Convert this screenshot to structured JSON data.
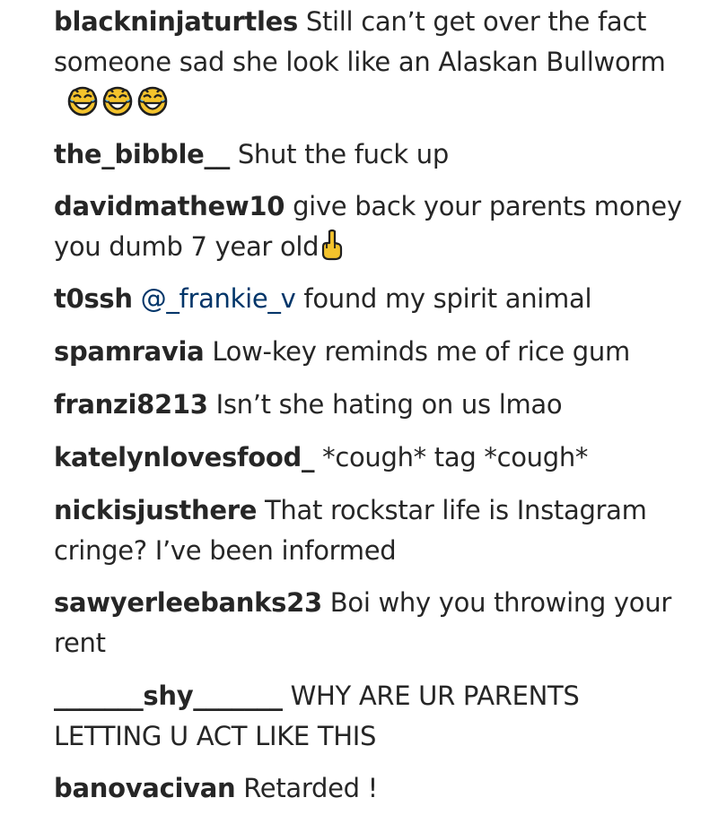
{
  "comments": [
    {
      "username": "blackninjaturtles",
      "text": "Still can’t get over the fact someone sad she look like an Alaskan Bullworm",
      "emojis": [
        "joy-cat-face-icon",
        "joy-cat-face-icon",
        "joy-cat-face-icon"
      ]
    },
    {
      "username": "the_bibble__",
      "text": "Shut the fuck up"
    },
    {
      "username": "davidmathew10",
      "text": "give back your parents money you dumb 7 year old",
      "emojis": [
        "middle-finger-icon"
      ]
    },
    {
      "username": "t0ssh",
      "mention": "@_frankie_v",
      "text": "found my spirit animal"
    },
    {
      "username": "spamravia",
      "text": "Low-key reminds me of rice gum"
    },
    {
      "username": "franzi8213",
      "text": "Isn’t she hating on us lmao"
    },
    {
      "username": "katelynlovesfood_",
      "text": "*cough* tag *cough*"
    },
    {
      "username": "nickisjusthere",
      "text": "That rockstar life is Instagram cringe? I’ve been informed"
    },
    {
      "username": "sawyerleebanks23",
      "text": "Boi why you throwing your rent"
    },
    {
      "username": "_______shy_______",
      "text": "WHY ARE UR PARENTS LETTING U ACT LIKE THIS"
    },
    {
      "username": "banovacivan",
      "text": "Retarded !"
    }
  ],
  "colors": {
    "text": "#262626",
    "mention": "#003569",
    "background": "#ffffff"
  }
}
